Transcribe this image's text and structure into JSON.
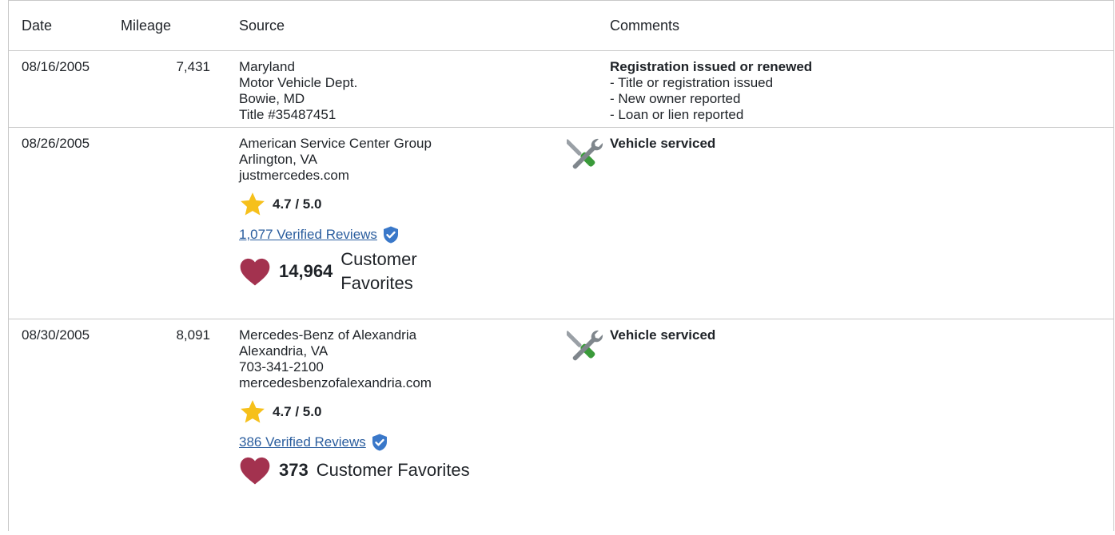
{
  "table": {
    "headers": {
      "date": "Date",
      "mileage": "Mileage",
      "source": "Source",
      "comments": "Comments"
    },
    "rows": [
      {
        "date": "08/16/2005",
        "mileage": "7,431",
        "source_lines": [
          "Maryland",
          "Motor Vehicle Dept.",
          "Bowie, MD",
          "Title #35487451"
        ],
        "comment_title": "Registration issued or renewed",
        "comment_lines": [
          "- Title or registration issued",
          "- New owner reported",
          "- Loan or lien reported"
        ]
      },
      {
        "date": "08/26/2005",
        "mileage": "",
        "source_lines": [
          "American Service Center Group",
          "Arlington, VA",
          "justmercedes.com"
        ],
        "rating": "4.7 / 5.0",
        "reviews": "1,077 Verified Reviews",
        "favorites_count": "14,964",
        "favorites_label": "Customer Favorites",
        "comment_title": "Vehicle serviced",
        "icon": "service-tools-icon"
      },
      {
        "date": "08/30/2005",
        "mileage": "8,091",
        "source_lines": [
          "Mercedes-Benz of Alexandria",
          "Alexandria, VA",
          "703-341-2100",
          "mercedesbenzofalexandria.com"
        ],
        "rating": "4.7 / 5.0",
        "reviews": "386 Verified Reviews",
        "favorites_count": "373",
        "favorites_label": "Customer Favorites",
        "comment_title": "Vehicle serviced",
        "icon": "service-tools-icon"
      }
    ]
  },
  "colors": {
    "star": "#f6c01b",
    "heart": "#a3324f",
    "verified": "#3a78c9",
    "link": "#2a5d9e",
    "border": "#c8c8c8"
  }
}
